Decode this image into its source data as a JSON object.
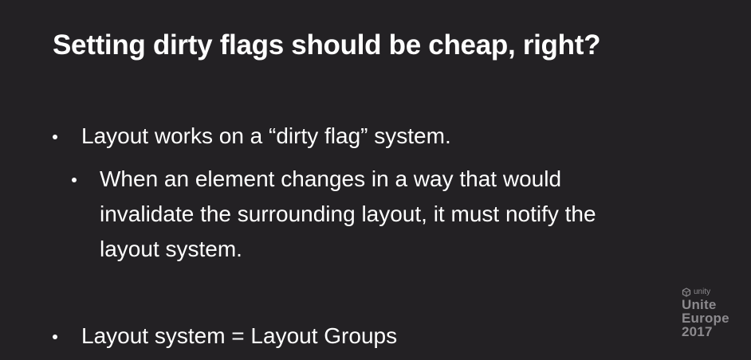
{
  "slide": {
    "title": "Setting dirty flags should be cheap, right?",
    "bullets": [
      {
        "level": 1,
        "text": "Layout works on a “dirty flag” system."
      },
      {
        "level": 2,
        "text": "When an element changes in a way that would invalidate the surrounding layout, it must notify the layout system."
      },
      {
        "level": 1,
        "text": "Layout system = Layout Groups"
      }
    ]
  },
  "logo": {
    "brand_small": "unity",
    "line1": "Unite",
    "line2": "Europe",
    "line3": "2017"
  },
  "colors": {
    "background": "#232124",
    "text": "#ffffff",
    "logo": "#8c8a8e"
  },
  "icons": {
    "brand": "unity-cube-icon"
  }
}
